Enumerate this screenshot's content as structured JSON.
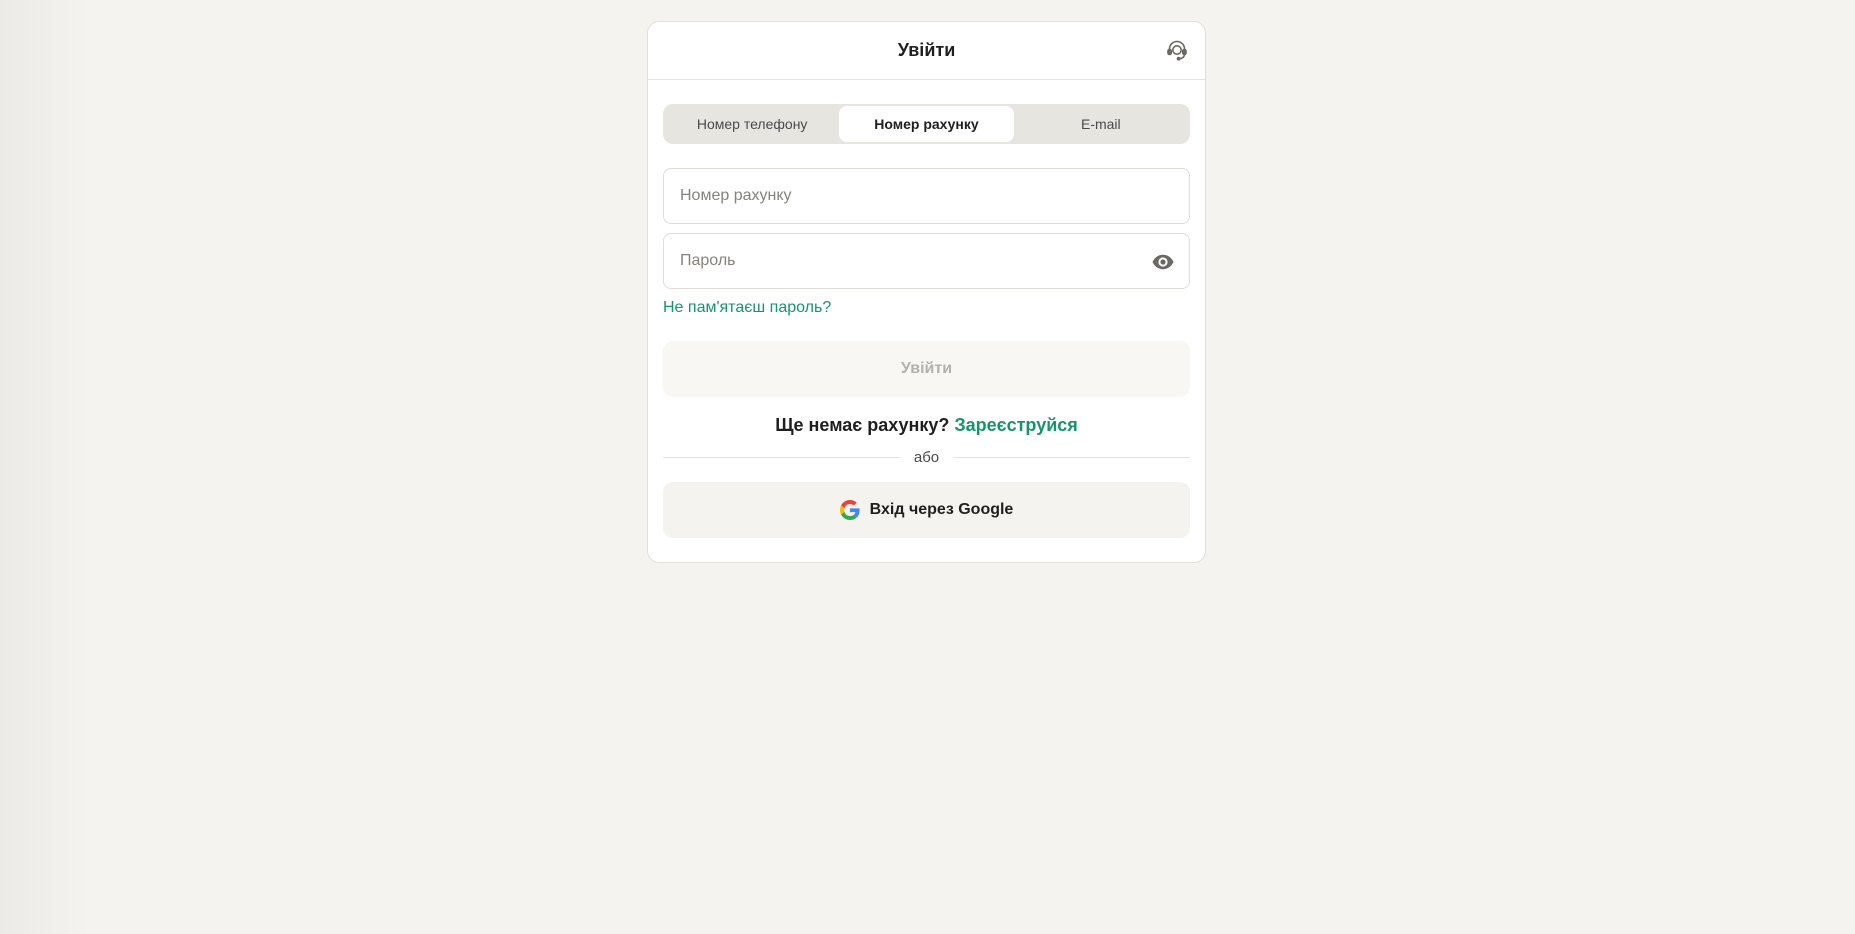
{
  "header": {
    "title": "Увійти",
    "support_icon": "headset-icon"
  },
  "tabs": [
    {
      "label": "Номер телефону",
      "active": false
    },
    {
      "label": "Номер рахунку",
      "active": true
    },
    {
      "label": "E-mail",
      "active": false
    }
  ],
  "form": {
    "account_placeholder": "Номер рахунку",
    "account_value": "",
    "password_placeholder": "Пароль",
    "password_value": "",
    "password_toggle_icon": "eye-icon",
    "forgot_label": "Не пам'ятаєш пароль?",
    "submit_label": "Увійти"
  },
  "register": {
    "prompt": "Ще немає рахунку?",
    "link_label": "Зареєструйся"
  },
  "divider": {
    "label": "або"
  },
  "google": {
    "label": "Вхід через Google",
    "icon": "google-icon"
  },
  "colors": {
    "accent": "#17956a",
    "background": "#f4f3ef",
    "disabled_text": "#b3b1ab"
  }
}
